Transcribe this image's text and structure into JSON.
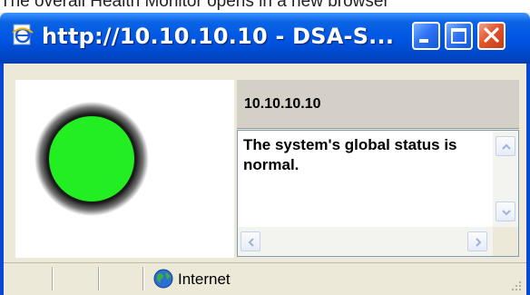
{
  "caption": "The overall Health Monitor opens in a new browser",
  "window": {
    "title": "http://10.10.10.10 - DSA-S..."
  },
  "host": {
    "label": "10.10.10.10"
  },
  "status": {
    "message": "The system's global status is normal.",
    "light_color": "#22ee22"
  },
  "statusbar": {
    "zone_label": "Internet"
  }
}
